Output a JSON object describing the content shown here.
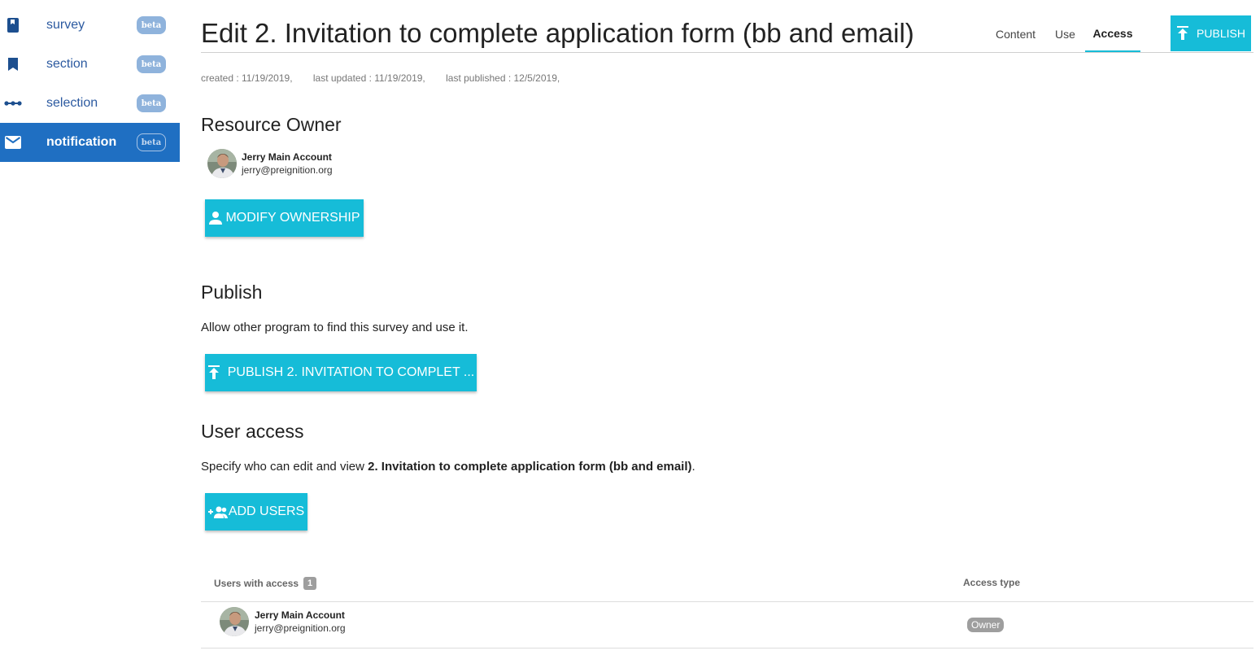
{
  "sidebar": {
    "items": [
      {
        "label": "survey",
        "badge": "beta",
        "icon": "book-icon"
      },
      {
        "label": "section",
        "badge": "beta",
        "icon": "bookmark-icon"
      },
      {
        "label": "selection",
        "badge": "beta",
        "icon": "dots-line-icon"
      },
      {
        "label": "notification",
        "badge": "beta",
        "icon": "mail-icon",
        "active": true
      }
    ]
  },
  "header": {
    "title": "Edit 2. Invitation to complete application form (bb and email)",
    "tabs": [
      {
        "label": "Content"
      },
      {
        "label": "Use"
      },
      {
        "label": "Access",
        "active": true
      }
    ],
    "publish_label": "PUBLISH"
  },
  "meta": {
    "created": "created : 11/19/2019,",
    "last_updated": "last updated : 11/19/2019,",
    "last_published": "last published : 12/5/2019,"
  },
  "resource_owner": {
    "heading": "Resource Owner",
    "name": "Jerry Main Account",
    "email": "jerry@preignition.org",
    "modify_label": "MODIFY OWNERSHIP"
  },
  "publish": {
    "heading": "Publish",
    "description": "Allow other program to find this survey and use it.",
    "button_label": "PUBLISH 2. INVITATION TO COMPLET ..."
  },
  "user_access": {
    "heading": "User access",
    "description_prefix": "Specify who can edit and view ",
    "description_target": "2. Invitation to complete application form (bb and email)",
    "description_suffix": ".",
    "add_users_label": "ADD USERS",
    "table": {
      "col_users": "Users with access",
      "count": "1",
      "col_access": "Access type",
      "rows": [
        {
          "name": "Jerry Main Account",
          "email": "jerry@preignition.org",
          "access": "Owner"
        }
      ]
    }
  },
  "colors": {
    "accent": "#16bcd8",
    "sidebar_active": "#1f6fc2",
    "sidebar_text": "#2c5aa0",
    "badge": "#8fb3dc"
  }
}
